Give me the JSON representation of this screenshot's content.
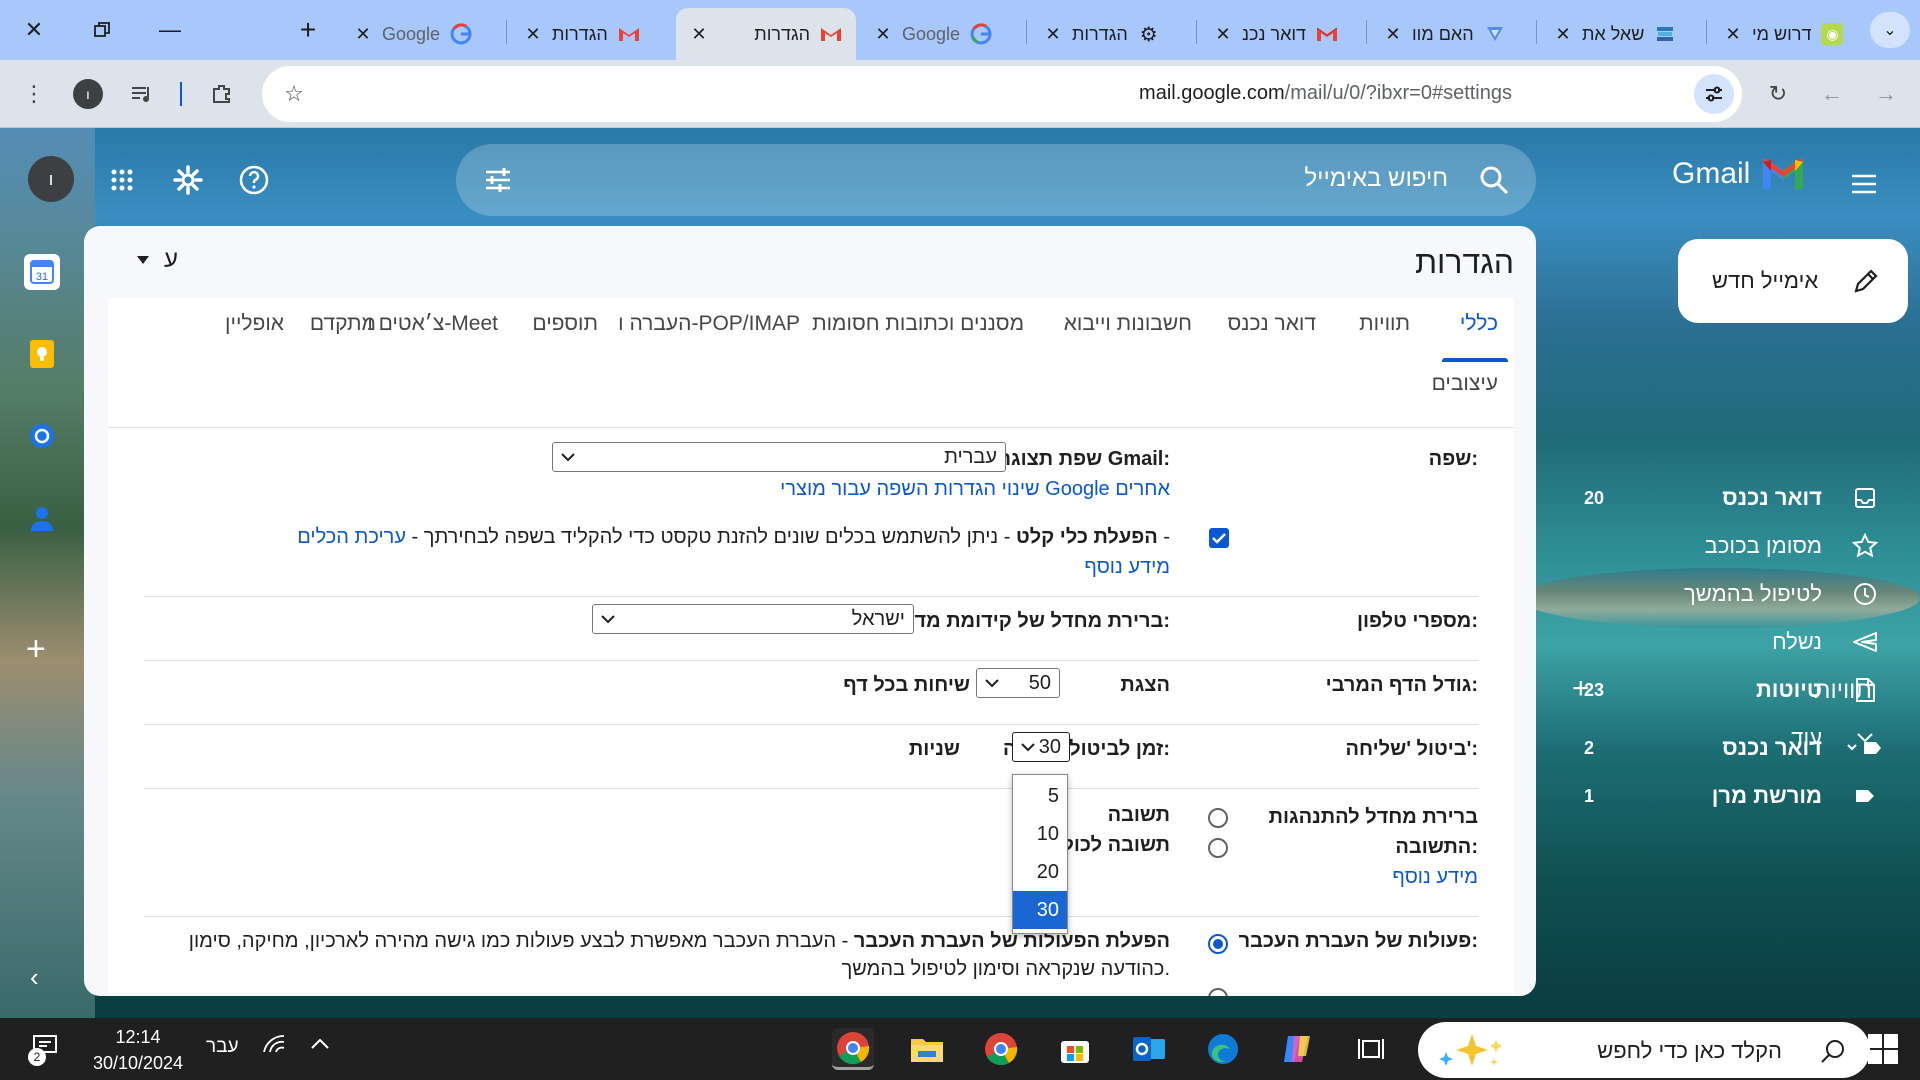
{
  "browser": {
    "tabs": [
      {
        "title": "דרוש מי",
        "icon": "green-site-icon",
        "active": false
      },
      {
        "title": "שאל את",
        "icon": "stacked-books-icon",
        "active": false
      },
      {
        "title": "האם מוו",
        "icon": "blue-shield-icon",
        "active": false
      },
      {
        "title": "דואר נכנ",
        "icon": "gmail-icon",
        "active": false
      },
      {
        "title": "הגדרות",
        "icon": "gear-icon",
        "active": false
      },
      {
        "title": "Google",
        "icon": "google-icon",
        "active": false
      },
      {
        "title": "הגדרות",
        "icon": "gmail-icon",
        "active": true
      },
      {
        "title": "הגדרות",
        "icon": "gmail-icon",
        "active": false
      },
      {
        "title": "Google",
        "icon": "google-icon",
        "active": false
      }
    ],
    "url_host": "mail.google.com",
    "url_path": "/mail/u/0/?ibxr=0#settings",
    "profile_initial": "ı"
  },
  "gmail": {
    "logo_text": "Gmail",
    "search_placeholder": "חיפוש באימייל",
    "compose_label": "אימייל חדש",
    "avatar_initial": "ı",
    "nav": [
      {
        "label": "דואר נכנס",
        "count": "20",
        "icon": "inbox-icon",
        "bold": true
      },
      {
        "label": "מסומן בכוכב",
        "count": "",
        "icon": "star-icon",
        "bold": false
      },
      {
        "label": "לטיפול בהמשך",
        "count": "",
        "icon": "clock-icon",
        "bold": false
      },
      {
        "label": "נשלח",
        "count": "",
        "icon": "send-icon",
        "bold": false
      },
      {
        "label": "טיוטות",
        "count": "23",
        "icon": "draft-icon",
        "bold": true
      },
      {
        "label": "עוד",
        "count": "",
        "icon": "chevron-down-icon",
        "bold": false
      }
    ],
    "labels_title": "תוויות",
    "labels": [
      {
        "label": "דואר נכנס",
        "count": "2",
        "bold": true
      },
      {
        "label": "מורשת מרן",
        "count": "1",
        "bold": true
      }
    ]
  },
  "settings": {
    "title": "הגדרות",
    "input_tool_label": "ע",
    "tabs": [
      "כללי",
      "תוויות",
      "דואר נכנס",
      "חשבונות וייבוא",
      "מסננים וכתובות חסומות",
      "העברה ו-POP/IMAP",
      "תוספים",
      "צ׳אטים ו-Meet",
      "מתקדם",
      "אופליין",
      "עיצובים"
    ],
    "active_tab": "כללי",
    "language": {
      "label": "שפה:",
      "display_label": "שפת תצוגה של Gmail:",
      "display_value": "עברית",
      "change_link": "שינוי הגדרות השפה עבור מוצרי Google אחרים",
      "input_tools_bold": "הפעלת כלי קלט",
      "input_tools_text": " - ניתן להשתמש בכלים שונים להזנת טקסט כדי להקליד בשפה לבחירתך - ",
      "input_tools_edit_link": "עריכת הכלים",
      "input_tools_dash": " -",
      "learn_more": "מידע נוסף"
    },
    "phone": {
      "label": "מספרי טלפון:",
      "text": "ברירת מחדל של קידומת מדינה:",
      "value": "ישראל"
    },
    "page_size": {
      "label": "גודל הדף המרבי:",
      "show": "הצגת",
      "value": "50",
      "suffix": "שיחות בכל דף"
    },
    "undo_send": {
      "label": "ביטול 'שליחה':",
      "text": "זמן לביטול שליחה:",
      "value": "30",
      "suffix": "שניות",
      "options": [
        "5",
        "10",
        "20",
        "30"
      ],
      "selected": "30"
    },
    "reply": {
      "label_line1": "ברירת מחדל להתנהגות",
      "label_line2": "התשובה:",
      "learn_more": "מידע נוסף",
      "options": [
        "תשובה",
        "תשובה לכולם"
      ]
    },
    "hover": {
      "label": "פעולות של העברת העכבר:",
      "enable_bold": "הפעלת הפעולות של העברת העכבר",
      "enable_text": " - העברת העכבר מאפשרת לבצע פעולות כמו גישה מהירה לארכיון, מחיקה, סימון",
      "enable_text2": "כהודעה שנקראה וסימון לטיפול בהמשך."
    }
  },
  "taskbar": {
    "search_placeholder": "הקלד כאן כדי לחפש",
    "time": "12:14",
    "date": "30/10/2024",
    "language": "עבר",
    "notification_count": "2",
    "apps": [
      "task-view-icon",
      "copilot-icon",
      "edge-icon",
      "outlook-icon",
      "store-icon",
      "chrome-icon",
      "file-explorer-icon",
      "chrome-profile-icon"
    ]
  },
  "colors": {
    "accent": "#0b57d0",
    "tabstrip": "#a8c7fa",
    "toolbar": "#dde3ea"
  }
}
